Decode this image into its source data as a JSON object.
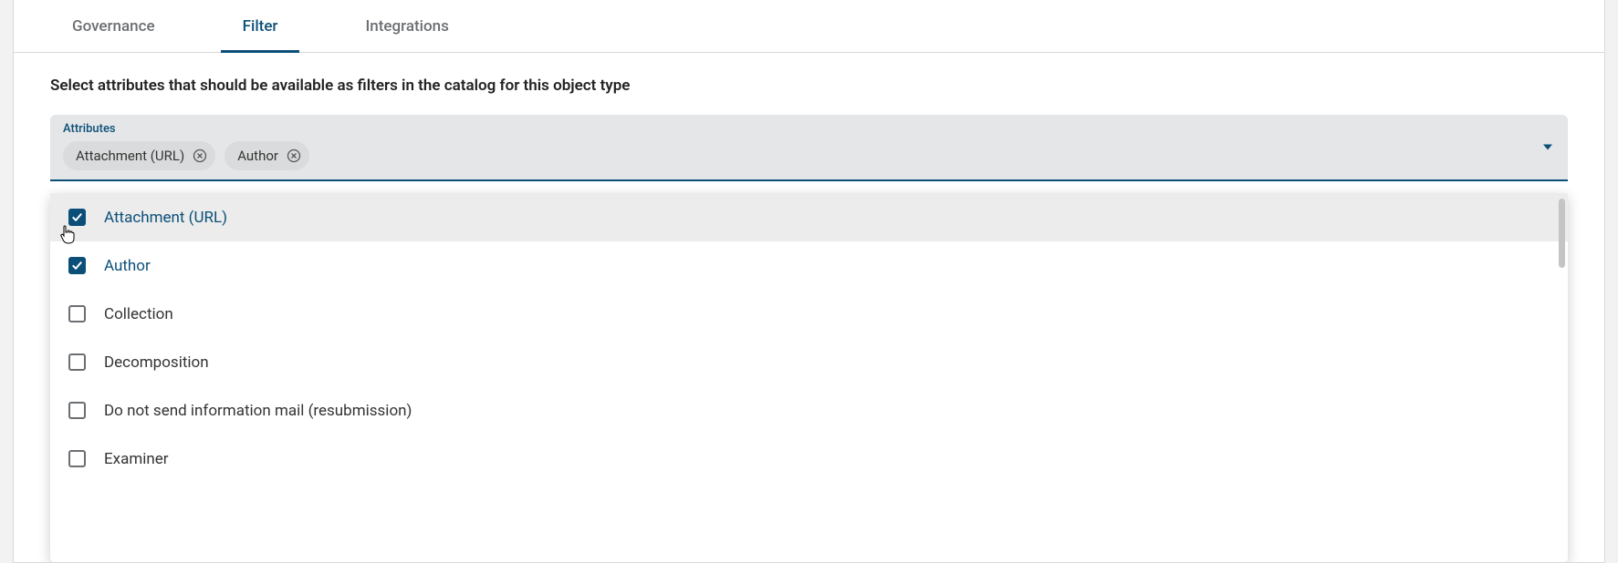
{
  "tabs": {
    "governance": "Governance",
    "filter": "Filter",
    "integrations": "Integrations",
    "active": "filter"
  },
  "description": "Select attributes that should be available as filters in the catalog for this object type",
  "field": {
    "label": "Attributes",
    "chips": [
      {
        "label": "Attachment (URL)"
      },
      {
        "label": "Author"
      }
    ]
  },
  "options": [
    {
      "label": "Attachment (URL)",
      "checked": true,
      "hovered": true
    },
    {
      "label": "Author",
      "checked": true,
      "hovered": false
    },
    {
      "label": "Collection",
      "checked": false,
      "hovered": false
    },
    {
      "label": "Decomposition",
      "checked": false,
      "hovered": false
    },
    {
      "label": "Do not send information mail (resubmission)",
      "checked": false,
      "hovered": false
    },
    {
      "label": "Examiner",
      "checked": false,
      "hovered": false
    }
  ]
}
